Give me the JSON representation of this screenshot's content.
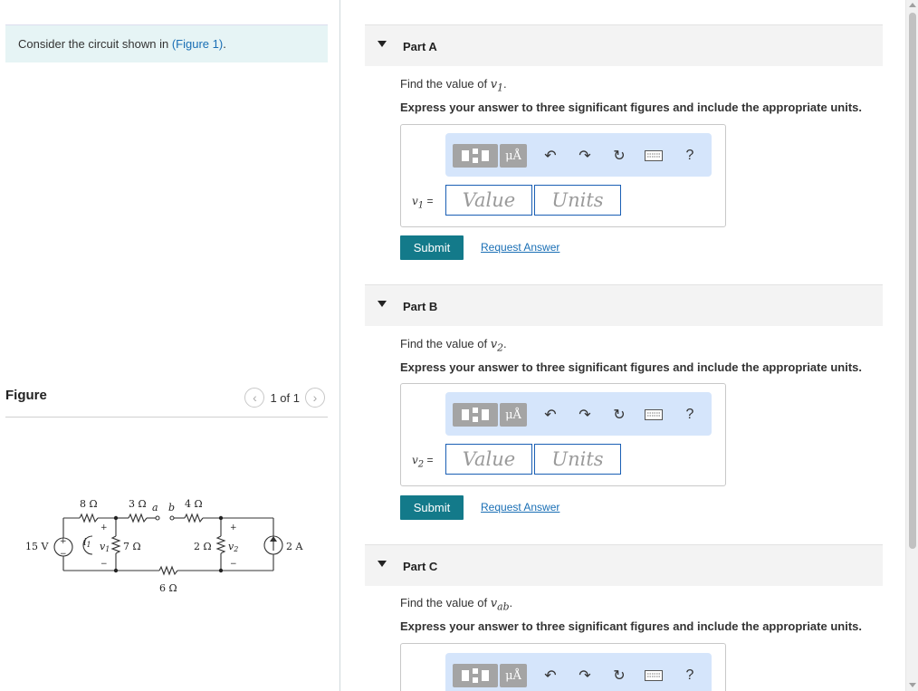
{
  "intro": {
    "text": "Consider the circuit shown in",
    "link": "(Figure 1)",
    "period": "."
  },
  "figure": {
    "label": "Figure",
    "pager": "1 of 1",
    "circuit": {
      "source_voltage": "15 V",
      "source_current": "2 A",
      "r1": "8 Ω",
      "r2": "3 Ω",
      "r3": "4 Ω",
      "r4": "7 Ω",
      "r5": "2 Ω",
      "r6": "6 Ω",
      "node_a": "a",
      "node_b": "b",
      "v1": "v",
      "v1_sub": "1",
      "v2": "v",
      "v2_sub": "2",
      "i1": "i",
      "i1_sub": "1",
      "plus": "+",
      "minus": "−"
    }
  },
  "parts": [
    {
      "title": "Part A",
      "prompt": "Find the value of",
      "var": "v",
      "var_sub": "1",
      "instruction": "Express your answer to three significant figures and include the appropriate units.",
      "answer_label_var": "v",
      "answer_label_sub": "1",
      "answer_label_eq": " =",
      "value_placeholder": "Value",
      "units_placeholder": "Units",
      "submit": "Submit",
      "request": "Request Answer"
    },
    {
      "title": "Part B",
      "prompt": "Find the value of",
      "var": "v",
      "var_sub": "2",
      "instruction": "Express your answer to three significant figures and include the appropriate units.",
      "answer_label_var": "v",
      "answer_label_sub": "2",
      "answer_label_eq": " =",
      "value_placeholder": "Value",
      "units_placeholder": "Units",
      "submit": "Submit",
      "request": "Request Answer"
    },
    {
      "title": "Part C",
      "prompt": "Find the value of",
      "var": "v",
      "var_sub": "ab",
      "instruction": "Express your answer to three significant figures and include the appropriate units."
    }
  ],
  "toolbar": {
    "units_button": "μÅ",
    "help": "?",
    "icons": [
      "fraction-template-icon",
      "units-icon",
      "undo-icon",
      "redo-icon",
      "reset-icon",
      "keyboard-icon",
      "help-icon"
    ]
  },
  "colors": {
    "accent": "#137a8a",
    "link": "#1a6fb5",
    "intro_bg": "#e6f4f5",
    "toolbar_bg": "#d5e5fb",
    "input_border": "#1a5fb4"
  }
}
